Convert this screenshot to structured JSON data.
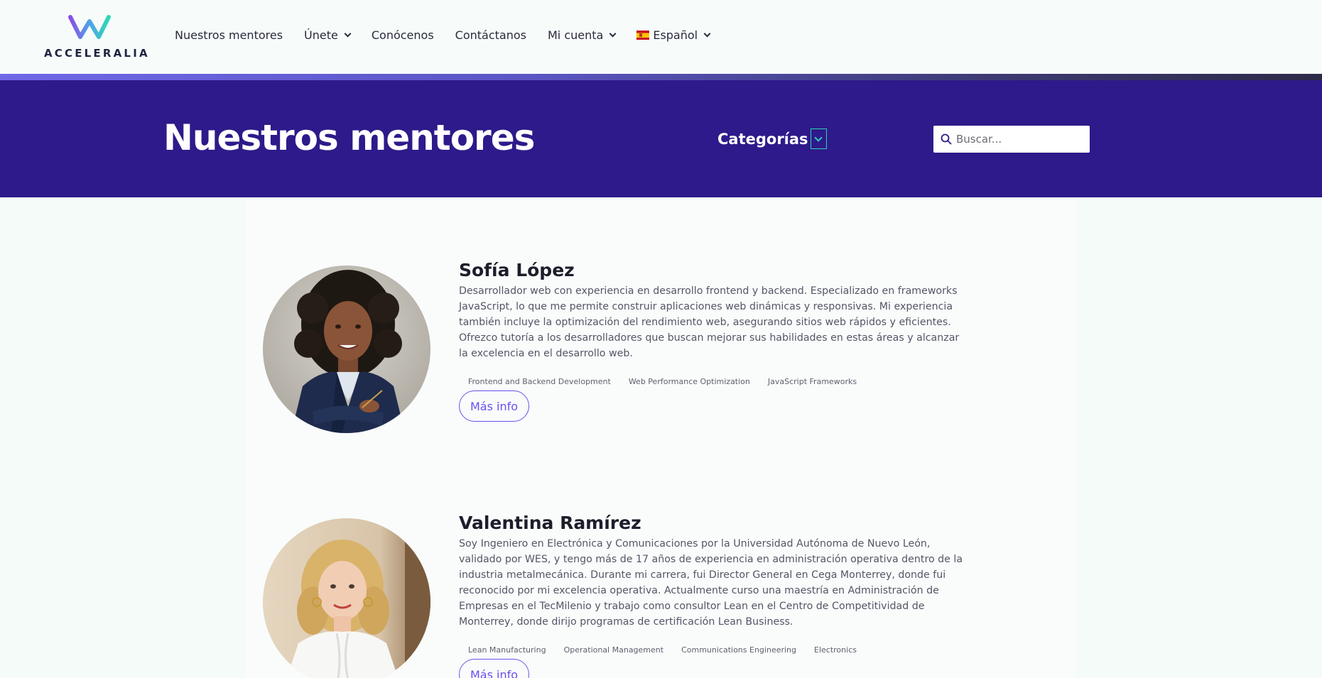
{
  "brand": {
    "name": "ACCELERALIA"
  },
  "nav": {
    "items": [
      {
        "label": "Nuestros mentores",
        "dropdown": false
      },
      {
        "label": "Únete",
        "dropdown": true
      },
      {
        "label": "Conócenos",
        "dropdown": false
      },
      {
        "label": "Contáctanos",
        "dropdown": false
      },
      {
        "label": "Mi cuenta",
        "dropdown": true
      }
    ],
    "language": {
      "label": "Español",
      "flag": "spain-flag-icon"
    }
  },
  "hero": {
    "title": "Nuestros mentores",
    "categories_label": "Categorías",
    "search_placeholder": "Buscar..."
  },
  "colors": {
    "hero_bg": "#2e1a8a",
    "accent": "#6c4ff0",
    "teal": "#2fd1b7"
  },
  "mentors": [
    {
      "name": "Sofía López",
      "bio": "Desarrollador web con experiencia en desarrollo frontend y backend. Especializado en frameworks JavaScript, lo que me permite construir aplicaciones web dinámicas y responsivas. Mi experiencia también incluye la optimización del rendimiento web, asegurando sitios web rápidos y eficientes. Ofrezco tutoría a los desarrolladores que buscan mejorar sus habilidades en estas áreas y alcanzar la excelencia en el desarrollo web.",
      "tags": [
        "Frontend and Backend Development",
        "Web Performance Optimization",
        "JavaScript Frameworks"
      ],
      "button": "Más info"
    },
    {
      "name": "Valentina Ramírez",
      "bio": "Soy Ingeniero en Electrónica y Comunicaciones por la Universidad Autónoma de Nuevo León, validado por WES, y tengo más de 17 años de experiencia en administración operativa dentro de la industria metalmecánica. Durante mi carrera, fui Director General en Cega Monterrey, donde fui reconocido por mi excelencia operativa. Actualmente curso una maestría en Administración de Empresas en el TecMilenio y trabajo como consultor Lean en el Centro de Competitividad de Monterrey, donde dirijo programas de certificación Lean Business.",
      "tags": [
        "Lean Manufacturing",
        "Operational Management",
        "Communications Engineering",
        "Electronics"
      ],
      "button": "Más info"
    }
  ]
}
